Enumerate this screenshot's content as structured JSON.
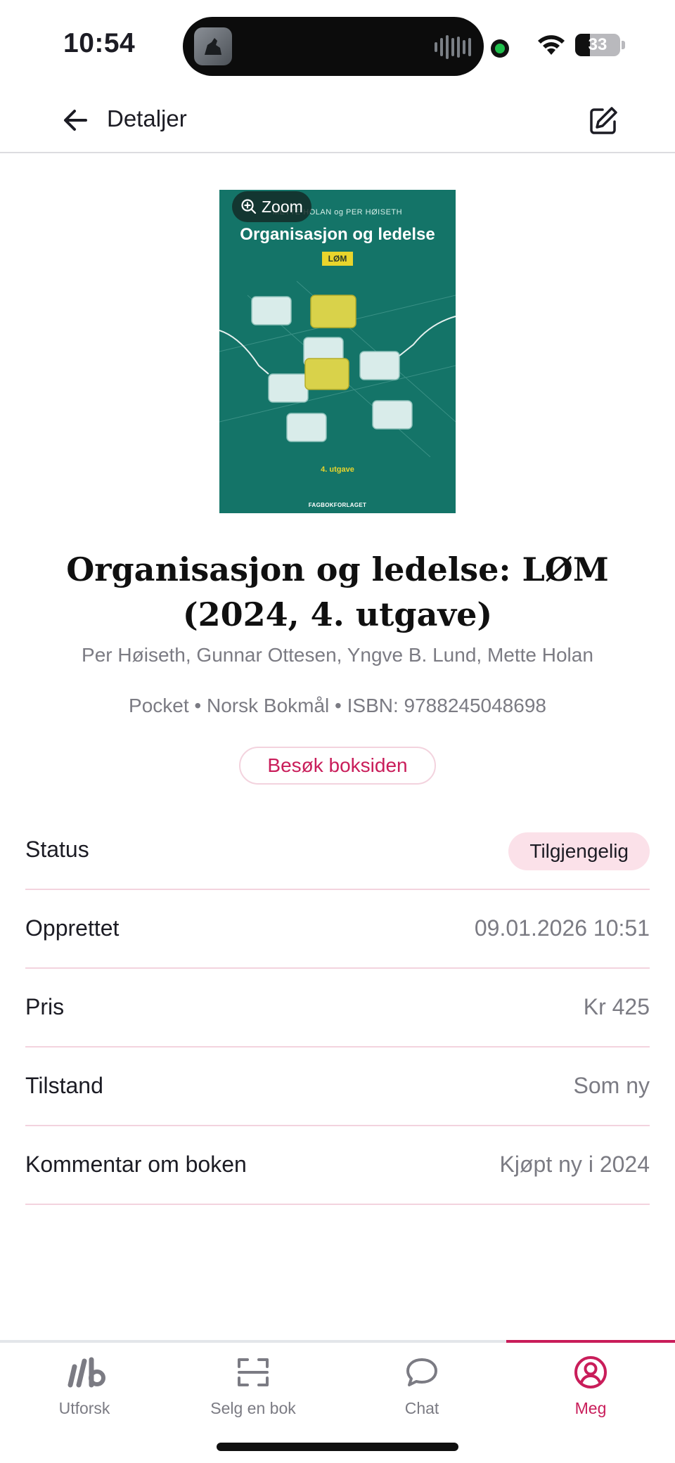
{
  "status_bar": {
    "time": "10:54",
    "battery_percent": "33",
    "battery_level": 0.33
  },
  "header": {
    "title": "Detaljer",
    "back_icon": "arrow-left-icon",
    "edit_icon": "edit-square-icon"
  },
  "cover": {
    "authors": "METTE HOLAN og PER HØISETH",
    "title": "Organisasjon og ledelse",
    "badge": "LØM",
    "edition": "4. utgave",
    "publisher": "FAGBOKFORLAGET",
    "zoom_label": "Zoom",
    "background_color": "#147468"
  },
  "book": {
    "title": "Organisasjon og ledelse: LØM (2024, 4. utgave)",
    "authors": "Per Høiseth, Gunnar Ottesen, Yngve B. Lund, Mette Holan",
    "meta": "Pocket • Norsk Bokmål • ISBN: 9788245048698",
    "visit_button": "Besøk boksiden"
  },
  "details": {
    "status_label": "Status",
    "status_value": "Tilgjengelig",
    "created_label": "Opprettet",
    "created_value": "09.01.2026 10:51",
    "price_label": "Pris",
    "price_value": "Kr 425",
    "condition_label": "Tilstand",
    "condition_value": "Som ny",
    "comment_label": "Kommentar om boken",
    "comment_value": "Kjøpt ny i 2024"
  },
  "tabs": [
    {
      "label": "Utforsk",
      "icon": "lb-logo-icon"
    },
    {
      "label": "Selg en bok",
      "icon": "scan-frame-icon"
    },
    {
      "label": "Chat",
      "icon": "chat-bubble-icon"
    },
    {
      "label": "Meg",
      "icon": "user-circle-icon",
      "active": true
    }
  ],
  "colors": {
    "accent": "#c91d5a",
    "accent_soft": "#fbe1e9",
    "muted_text": "#7b7b83",
    "divider": "#f3d3de"
  }
}
